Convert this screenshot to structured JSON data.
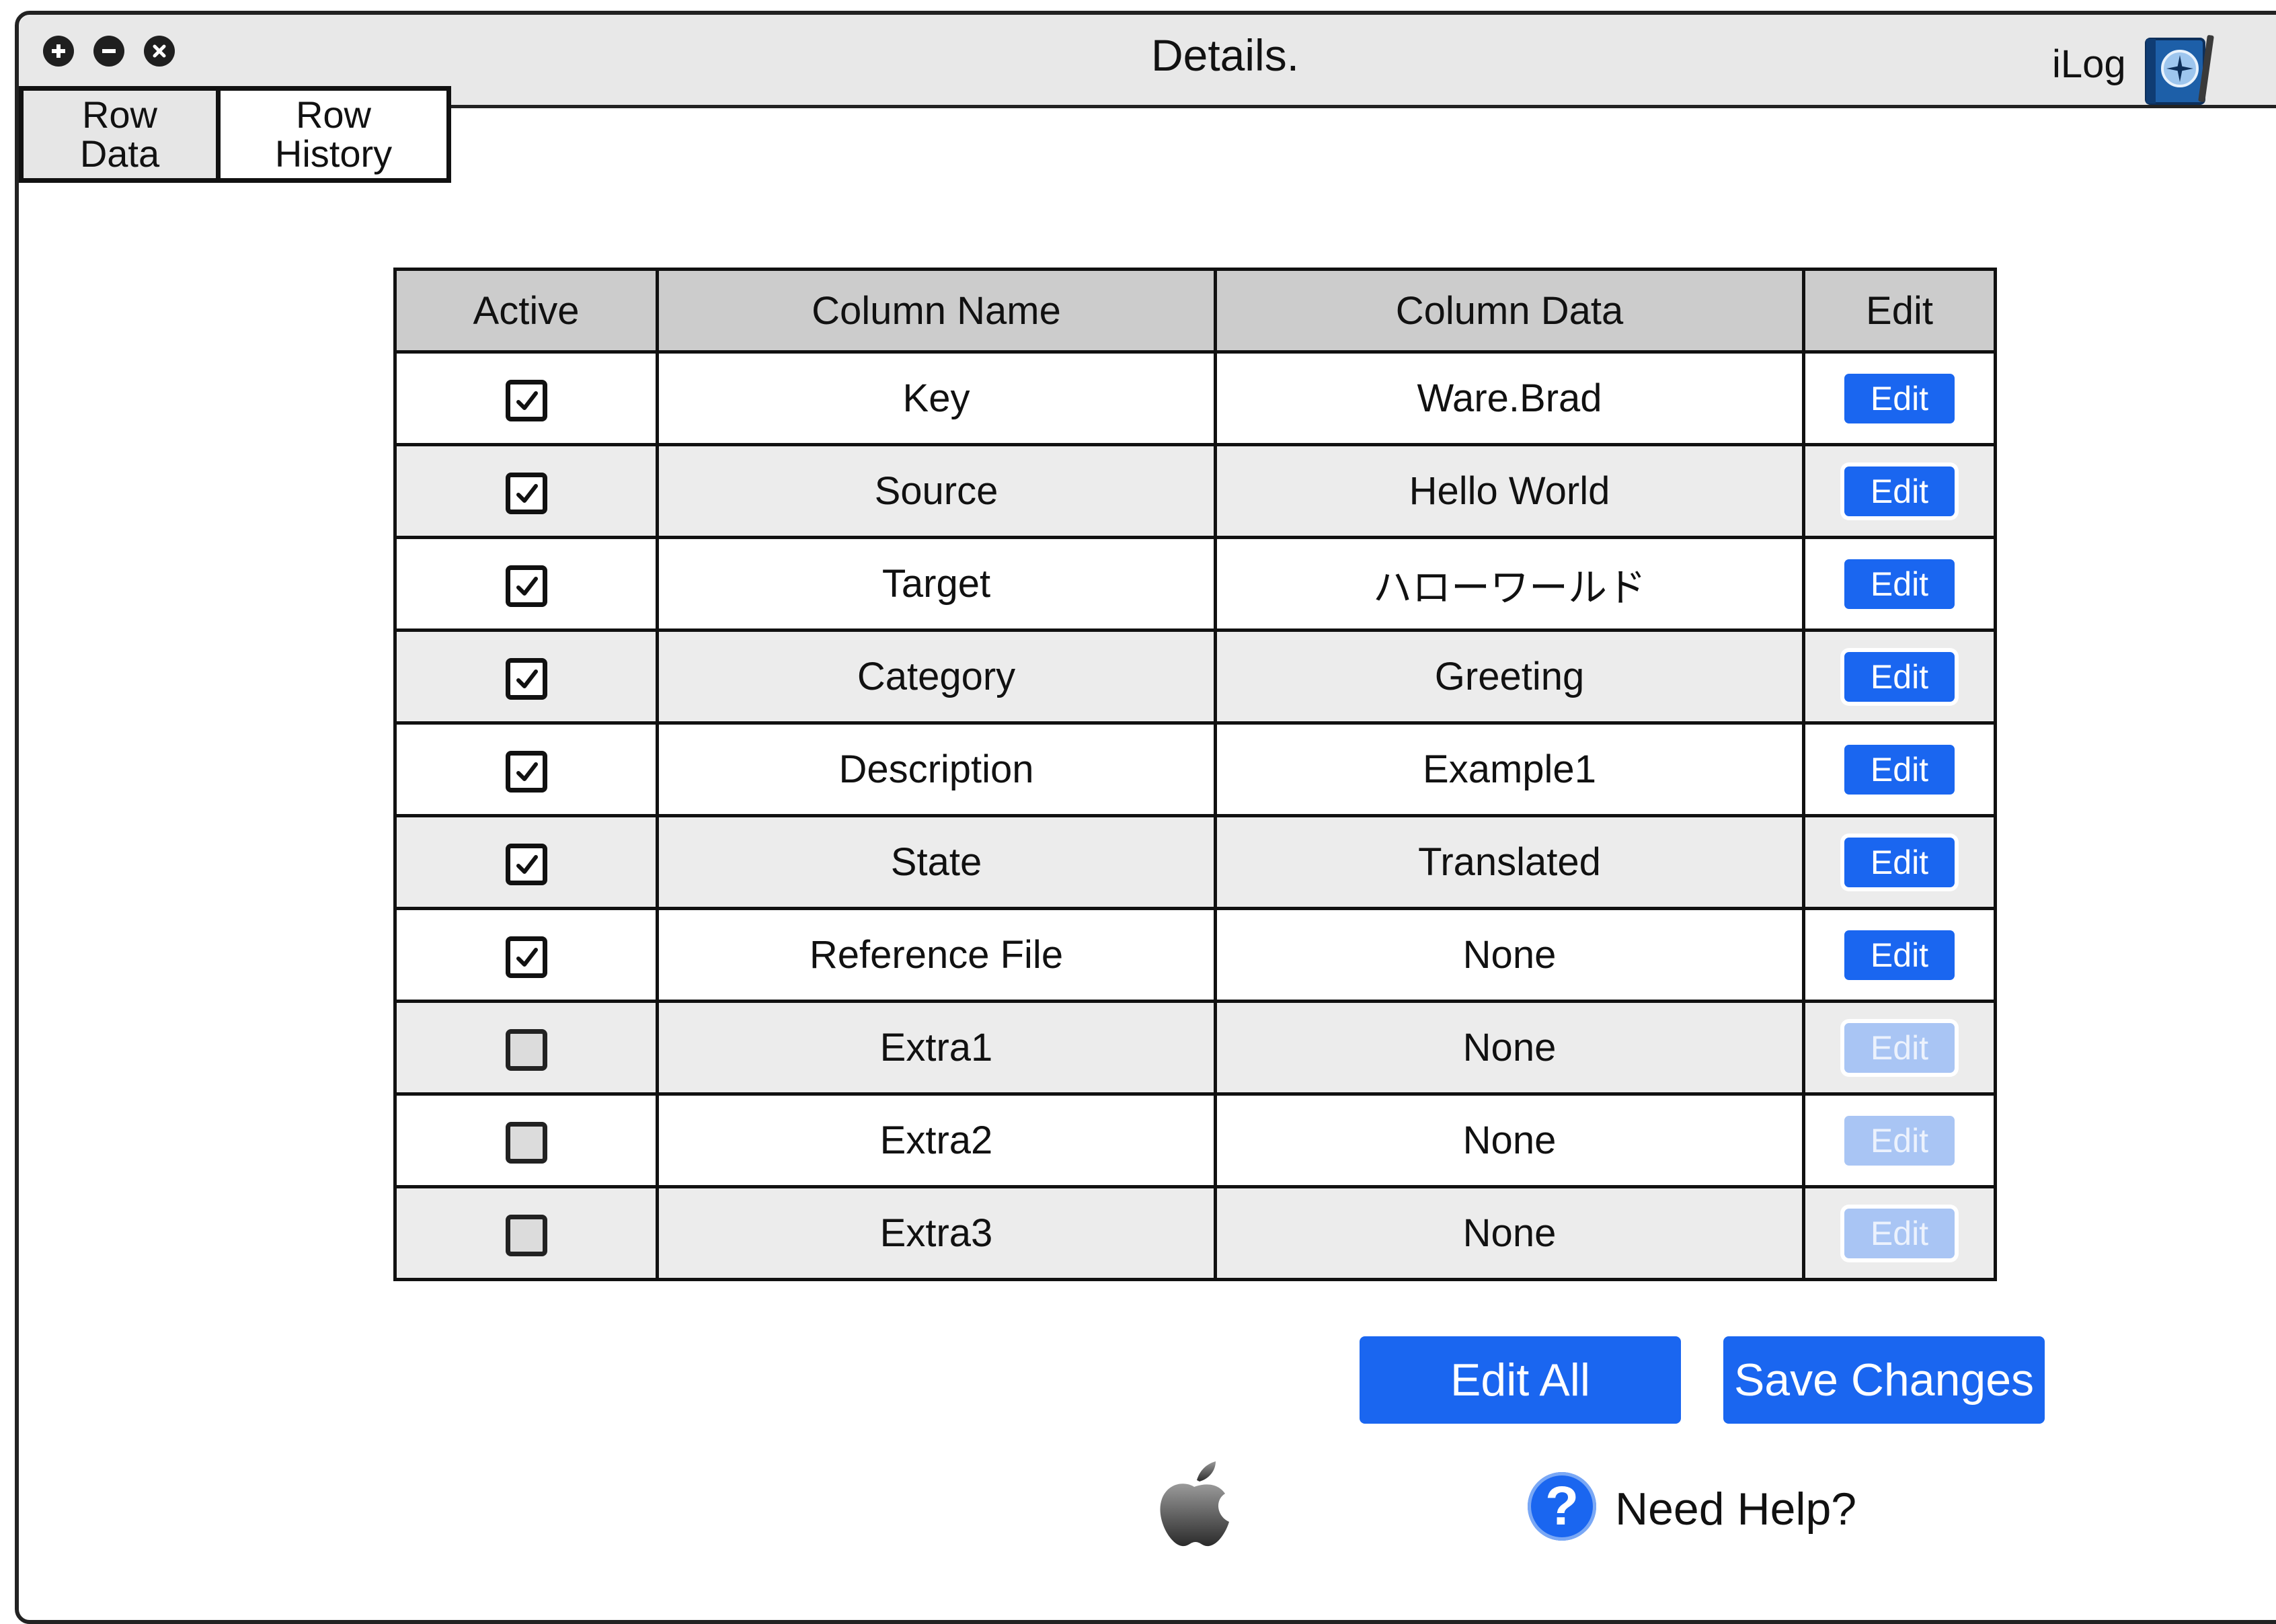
{
  "window": {
    "title": "Details.",
    "brand": "iLog",
    "controls": [
      "plus-icon",
      "minus-icon",
      "close-icon"
    ]
  },
  "tabs": [
    {
      "label_line1": "Row",
      "label_line2": "Data",
      "active": true
    },
    {
      "label_line1": "Row",
      "label_line2": "History",
      "active": false
    }
  ],
  "table": {
    "headers": [
      "Active",
      "Column Name",
      "Column Data",
      "Edit"
    ],
    "rows": [
      {
        "active": true,
        "name": "Key",
        "data": "Ware.Brad",
        "edit": "Edit",
        "edit_enabled": true
      },
      {
        "active": true,
        "name": "Source",
        "data": "Hello World",
        "edit": "Edit",
        "edit_enabled": true
      },
      {
        "active": true,
        "name": "Target",
        "data": "ハローワールド",
        "edit": "Edit",
        "edit_enabled": true
      },
      {
        "active": true,
        "name": "Category",
        "data": "Greeting",
        "edit": "Edit",
        "edit_enabled": true
      },
      {
        "active": true,
        "name": "Description",
        "data": "Example1",
        "edit": "Edit",
        "edit_enabled": true
      },
      {
        "active": true,
        "name": "State",
        "data": "Translated",
        "edit": "Edit",
        "edit_enabled": true
      },
      {
        "active": true,
        "name": "Reference File",
        "data": "None",
        "edit": "Edit",
        "edit_enabled": true
      },
      {
        "active": false,
        "name": "Extra1",
        "data": "None",
        "edit": "Edit",
        "edit_enabled": false
      },
      {
        "active": false,
        "name": "Extra2",
        "data": "None",
        "edit": "Edit",
        "edit_enabled": false
      },
      {
        "active": false,
        "name": "Extra3",
        "data": "None",
        "edit": "Edit",
        "edit_enabled": false
      }
    ]
  },
  "actions": {
    "edit_all": "Edit All",
    "save_changes": "Save Changes"
  },
  "footer": {
    "apple_icon": "apple-logo-icon",
    "help_icon": "question-mark-icon",
    "help_text": "Need Help?"
  },
  "colors": {
    "accent": "#1a66f0",
    "accent_disabled": "#a9c5f4",
    "header_bg": "#cccccc",
    "stripe_bg": "#ececec",
    "titlebar_bg": "#e8e8e8"
  }
}
